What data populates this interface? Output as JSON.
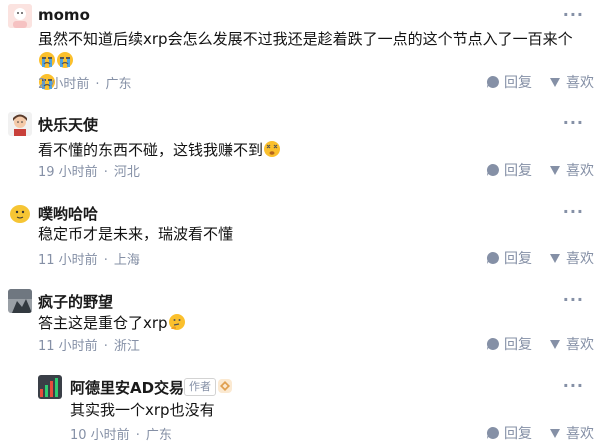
{
  "comments": [
    {
      "name": "momo",
      "content": "虽然不知道后续xrp会怎么发展不过我还是趁着跌了一点的这个节点入了一百来个",
      "time": "2 小时前",
      "location": "广东",
      "reply_label": "回复",
      "like_label": "喜欢",
      "emoji": [
        "crying-face",
        "crying-face",
        "crying-face"
      ]
    },
    {
      "name": "快乐天使",
      "content": "看不懂的东西不碰，这钱我赚不到",
      "time": "19 小时前",
      "location": "河北",
      "reply_label": "回复",
      "like_label": "喜欢",
      "emoji": [
        "dizzy-face"
      ]
    },
    {
      "name": "噗哟哈哈",
      "content": "稳定币才是未来，瑞波看不懂",
      "time": "11 小时前",
      "location": "上海",
      "reply_label": "回复",
      "like_label": "喜欢"
    },
    {
      "name": "疯子的野望",
      "content": "答主这是重仓了xrp",
      "time": "11 小时前",
      "location": "浙江",
      "reply_label": "回复",
      "like_label": "喜欢",
      "emoji": [
        "thinking-face"
      ]
    },
    {
      "name": "阿德里安AD交易",
      "author_tag": "作者",
      "content": "其实我一个xrp也没有",
      "time": "10 小时前",
      "location": "广东",
      "reply_label": "回复",
      "like_label": "喜欢"
    }
  ],
  "colors": {
    "meta": "#8590a6",
    "text": "#121212",
    "emoji_yellow": "#fbc02d"
  }
}
